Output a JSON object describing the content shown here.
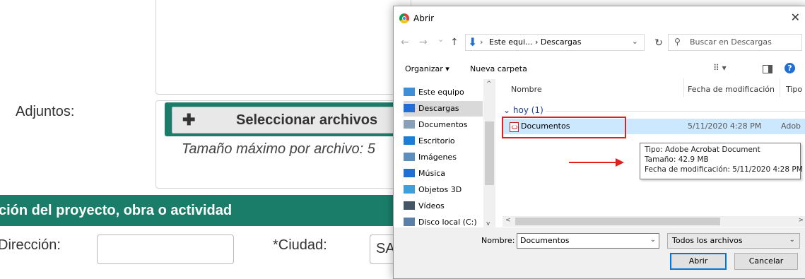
{
  "form": {
    "attachments_label": "Adjuntos:",
    "select_files_label": "Seleccionar archivos",
    "plus_glyph": "✚",
    "max_size_text": "Tamaño máximo por archivo: 5",
    "section_header": "ción del proyecto, obra o actividad",
    "address_label": "Dirección:",
    "city_label": "*Ciudad:",
    "city_select_partial": "SA"
  },
  "dialog": {
    "title": "Abrir",
    "close_glyph": "✕",
    "nav": {
      "back_glyph": "←",
      "forward_glyph": "→",
      "recent_glyph": "⌄",
      "up_glyph": "↑"
    },
    "address": {
      "path_chevron": "›",
      "path": "Este equi...  ›  Descargas",
      "dropdown_glyph": "⌄"
    },
    "refresh_glyph": "↻",
    "search": {
      "icon_glyph": "⚲",
      "placeholder": "Buscar en Descargas"
    },
    "toolbar": {
      "organize": "Organizar ▾",
      "new_folder": "Nueva carpeta",
      "views_glyph": "⠿ ▾",
      "help": "?"
    },
    "nav_pane": {
      "items": [
        {
          "label": "Este equipo",
          "icon": "computer-icon",
          "color": "#3c8fd8"
        },
        {
          "label": "Descargas",
          "icon": "download-icon",
          "color": "#1f6fd6",
          "selected": true
        },
        {
          "label": "Documentos",
          "icon": "documents-icon",
          "color": "#8aa0b8"
        },
        {
          "label": "Escritorio",
          "icon": "desktop-icon",
          "color": "#1a7fd8"
        },
        {
          "label": "Imágenes",
          "icon": "images-icon",
          "color": "#5a8fbf"
        },
        {
          "label": "Música",
          "icon": "music-icon",
          "color": "#1f6fd6"
        },
        {
          "label": "Objetos 3D",
          "icon": "objects3d-icon",
          "color": "#3ea0d8"
        },
        {
          "label": "Vídeos",
          "icon": "videos-icon",
          "color": "#445566"
        },
        {
          "label": "Disco local (C:)",
          "icon": "drive-icon",
          "color": "#5a7fa8"
        }
      ],
      "scroll_up": "^",
      "scroll_down": "v"
    },
    "columns": {
      "name": "Nombre",
      "date": "Fecha de modificación",
      "type": "Tipo"
    },
    "group": {
      "label": "hoy (1)",
      "chevron": "⌄"
    },
    "file": {
      "name": "Documentos",
      "date": "5/11/2020 4:28 PM",
      "type": "Adob"
    },
    "tooltip": {
      "type": "Tipo: Adobe Acrobat Document",
      "size": "Tamaño: 42.9 MB",
      "modified": "Fecha de modificación: 5/11/2020 4:28 PM"
    },
    "hscroll": {
      "left": "<",
      "right": ">"
    },
    "filename_label": "Nombre:",
    "filename_value": "Documentos",
    "filter_value": "Todos los archivos",
    "dropdown_glyph": "⌄",
    "open_button": "Abrir",
    "cancel_button": "Cancelar"
  },
  "colors": {
    "form_green": "#1a7d6a",
    "highlight_red": "#e0201b",
    "selection_blue": "#cce8ff"
  }
}
